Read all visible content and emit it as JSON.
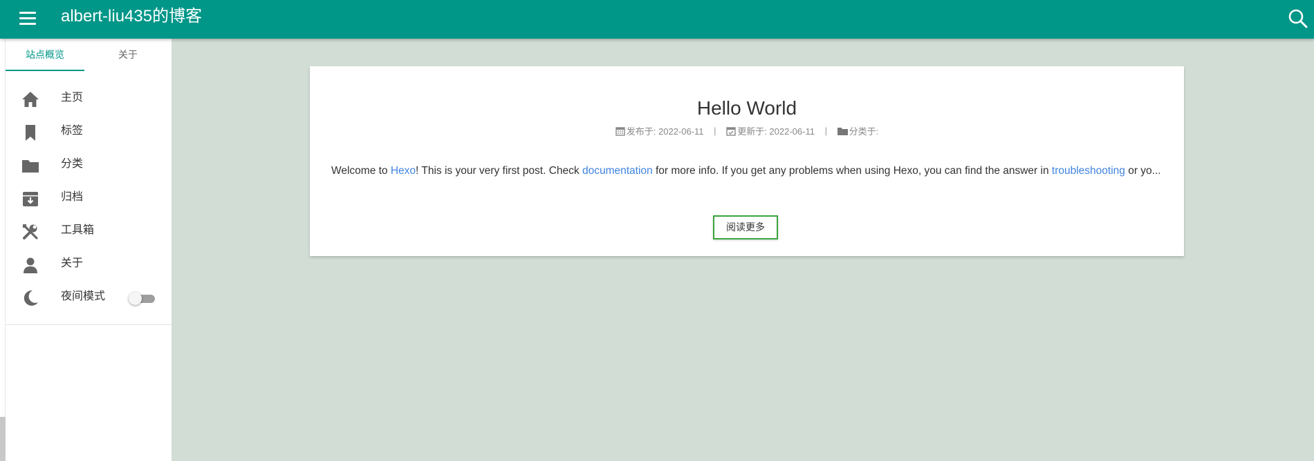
{
  "header": {
    "site_title": "albert-liu435的博客",
    "menu_icon": "menu-icon",
    "search_icon": "search-icon",
    "bg_color": "#009688"
  },
  "sidebar": {
    "tabs": [
      {
        "label": "站点概览",
        "active": true
      },
      {
        "label": "关于",
        "active": false
      }
    ],
    "items": [
      {
        "label": "主页",
        "icon": "home-icon"
      },
      {
        "label": "标签",
        "icon": "bookmark-icon"
      },
      {
        "label": "分类",
        "icon": "folder-icon"
      },
      {
        "label": "归档",
        "icon": "archive-icon"
      },
      {
        "label": "工具箱",
        "icon": "tools-icon"
      },
      {
        "label": "关于",
        "icon": "user-icon"
      },
      {
        "label": "夜间模式",
        "icon": "moon-icon",
        "toggle": false
      }
    ]
  },
  "post": {
    "title": "Hello World",
    "published_label": "发布于: 2022-06-11",
    "updated_label": "更新于: 2022-06-11",
    "category_label": "分类于:",
    "separator": "|",
    "excerpt": {
      "t1": "Welcome to ",
      "link1": "Hexo",
      "t2": "! This is your very first post. Check ",
      "link2": "documentation",
      "t3": " for more info. If you get any problems when using Hexo, you can find the answer in ",
      "link3": "troubleshooting",
      "t4": " or yo..."
    },
    "read_more_label": "阅读更多"
  },
  "colors": {
    "accent": "#009688",
    "link": "#3f83e0",
    "page_bg": "#d2ddd6",
    "button_border": "#3aa53d"
  }
}
